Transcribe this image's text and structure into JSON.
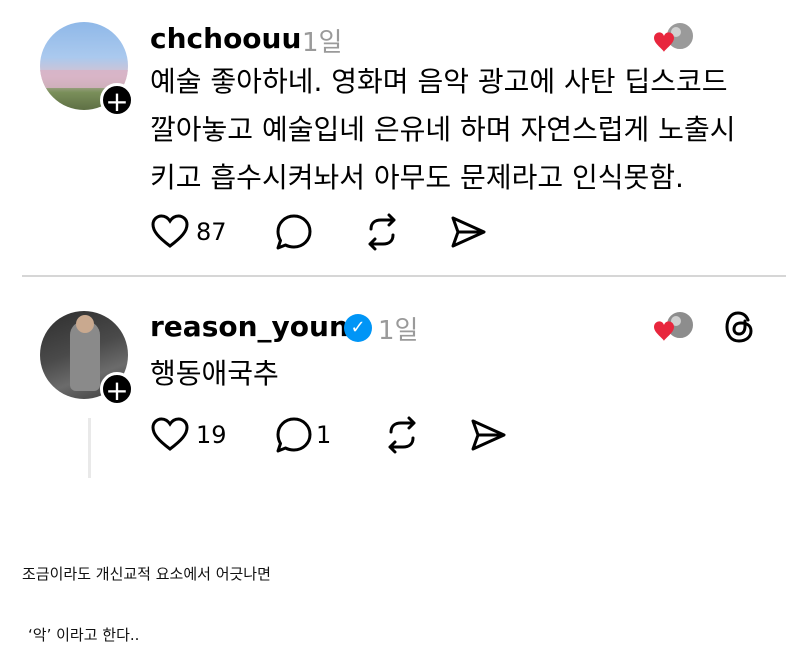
{
  "posts": [
    {
      "username": "chchoouu",
      "time": "1일",
      "text_lines": [
        "예술 좋아하네. 영화며 음악 광고에 사탄 딥스코드",
        "깔아놓고 예술입네 은유네 하며 자연스럽게 노출시",
        "키고 흡수시켜놔서 아무도 문제라고 인식못함."
      ],
      "likes": "87",
      "replies": "",
      "verified": false
    },
    {
      "username": "reason_youn",
      "time": "1일",
      "text_lines": [
        "행동애국추"
      ],
      "likes": "19",
      "replies": "1",
      "verified": true
    }
  ],
  "caption": {
    "line1": "조금이라도 개신교적 요소에서 어긋나면",
    "line2": "‘악’ 이라고 한다.."
  },
  "colors": {
    "heart_red": "#e8263d",
    "verified_blue": "#0095f6",
    "time_gray": "#9a9a9a"
  },
  "icons": [
    "heart-icon",
    "comment-icon",
    "repost-icon",
    "share-icon",
    "threads-logo-icon",
    "plus-icon",
    "verified-icon"
  ]
}
